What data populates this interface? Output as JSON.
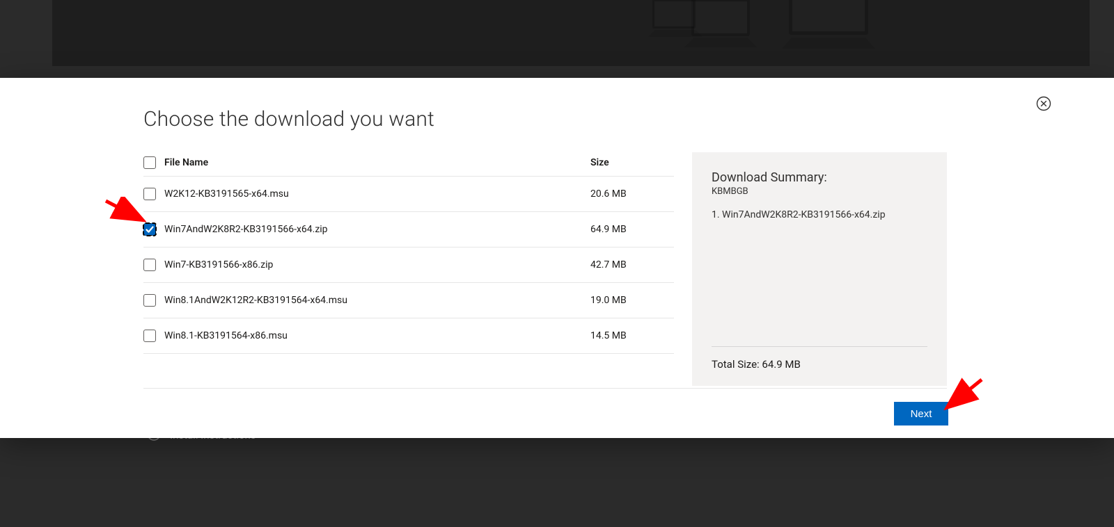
{
  "modal": {
    "title": "Choose the download you want",
    "columns": {
      "name": "File Name",
      "size": "Size"
    },
    "files": [
      {
        "name": "W2K12-KB3191565-x64.msu",
        "size": "20.6 MB",
        "checked": false
      },
      {
        "name": "Win7AndW2K8R2-KB3191566-x64.zip",
        "size": "64.9 MB",
        "checked": true
      },
      {
        "name": "Win7-KB3191566-x86.zip",
        "size": "42.7 MB",
        "checked": false
      },
      {
        "name": "Win8.1AndW2K12R2-KB3191564-x64.msu",
        "size": "19.0 MB",
        "checked": false
      },
      {
        "name": "Win8.1-KB3191564-x86.msu",
        "size": "14.5 MB",
        "checked": false
      }
    ],
    "next_label": "Next"
  },
  "summary": {
    "heading": "Download Summary:",
    "units": "KBMBGB",
    "items": [
      "1. Win7AndW2K8R2-KB3191566-x64.zip"
    ],
    "total_label": "Total Size:",
    "total_value": "64.9 MB"
  },
  "background": {
    "accordion_label": "Install Instructions"
  }
}
